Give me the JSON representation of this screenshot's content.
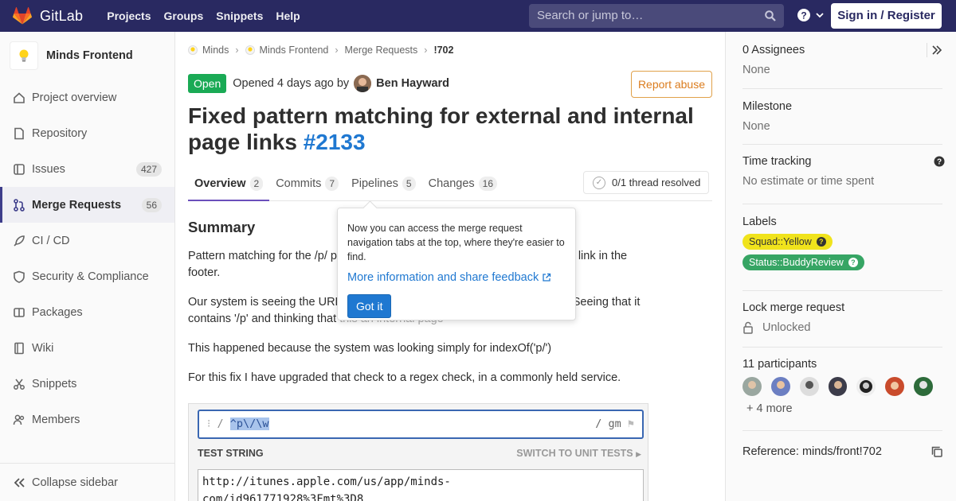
{
  "navbar": {
    "brand": "GitLab",
    "links": [
      "Projects",
      "Groups",
      "Snippets",
      "Help"
    ],
    "search_placeholder": "Search or jump to…",
    "signin": "Sign in / Register"
  },
  "sidebar": {
    "project_name": "Minds Frontend",
    "items": [
      {
        "label": "Project overview",
        "icon": "home-icon"
      },
      {
        "label": "Repository",
        "icon": "document-icon"
      },
      {
        "label": "Issues",
        "icon": "issues-icon",
        "badge": "427"
      },
      {
        "label": "Merge Requests",
        "icon": "merge-request-icon",
        "badge": "56",
        "active": true
      },
      {
        "label": "CI / CD",
        "icon": "rocket-icon"
      },
      {
        "label": "Security & Compliance",
        "icon": "shield-icon"
      },
      {
        "label": "Packages",
        "icon": "package-icon"
      },
      {
        "label": "Wiki",
        "icon": "book-icon"
      },
      {
        "label": "Snippets",
        "icon": "scissors-icon"
      },
      {
        "label": "Members",
        "icon": "users-icon"
      }
    ],
    "collapse": "Collapse sidebar"
  },
  "breadcrumb": {
    "items": [
      "Minds",
      "Minds Frontend",
      "Merge Requests"
    ],
    "current": "!702"
  },
  "mr": {
    "status": "Open",
    "opened": "Opened 4 days ago by",
    "author": "Ben Hayward",
    "report": "Report abuse",
    "title": "Fixed pattern matching for external and internal page links",
    "ref": "#2133"
  },
  "tabs": [
    {
      "label": "Overview",
      "count": "2",
      "active": true
    },
    {
      "label": "Commits",
      "count": "7"
    },
    {
      "label": "Pipelines",
      "count": "5"
    },
    {
      "label": "Changes",
      "count": "16"
    }
  ],
  "threads": "0/1 thread resolved",
  "body": {
    "heading": "Summary",
    "p1_start": "Pattern matching for the /p/ pa",
    "p1_end": "nd click the iOS link in the",
    "p1_line2": "footer.",
    "p2_start": "Our system is seeing the URL",
    "p2_end": "928%3Fmt Seeing that it",
    "p2_line2_start": "contains '/p' and thinking that",
    "p2_line2_end": "this an internal page",
    "p3": "This happened because the system was looking simply for indexOf('p/')",
    "p4": "For this fix I have upgraded that check to a regex check, in a commonly held service."
  },
  "regex": {
    "delim_open": "/",
    "pattern_a": "^p",
    "pattern_b": "\\/\\w",
    "flags": "/ gm",
    "test_label": "TEST STRING",
    "unit_label": "SWITCH TO UNIT TESTS",
    "test_line1": "http://itunes.apple.com/us/app/minds-",
    "test_line2": "com/id961771928%3Fmt%3D8"
  },
  "popover": {
    "text": "Now you can access the merge request navigation tabs at the top, where they're easier to find.",
    "link": "More information and share feedback",
    "button": "Got it"
  },
  "right": {
    "assignees_title": "0 Assignees",
    "assignees_value": "None",
    "milestone_title": "Milestone",
    "milestone_value": "None",
    "time_title": "Time tracking",
    "time_value": "No estimate or time spent",
    "labels_title": "Labels",
    "label1": "Squad::Yellow",
    "label2": "Status::BuddyReview",
    "lock_title": "Lock merge request",
    "lock_value": "Unlocked",
    "participants_title": "11 participants",
    "more": "+ 4 more",
    "reference": "Reference: minds/front!702"
  },
  "colors": {
    "navbar": "#292961",
    "open": "#1aaa55",
    "link": "#1f78d1",
    "report": "#db7c1d",
    "label_yellow": "#f0e31c",
    "label_green": "#36a564"
  }
}
